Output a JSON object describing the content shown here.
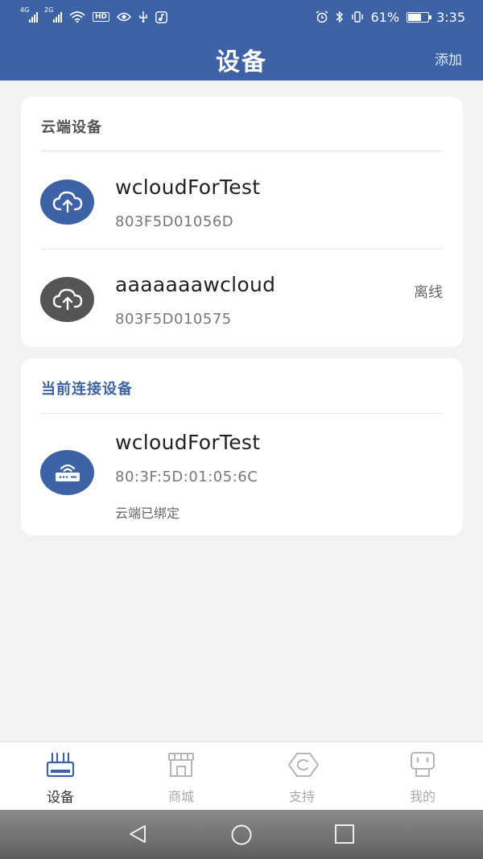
{
  "status_bar": {
    "signal1_tag": "4G",
    "signal2_tag": "2G",
    "hd_badge": "HD",
    "battery_percent": "61%",
    "battery_level": 0.61,
    "time": "3:35"
  },
  "header": {
    "title": "设备",
    "add_label": "添加"
  },
  "cloud_section": {
    "title": "云端设备",
    "devices": [
      {
        "name": "wcloudForTest",
        "mac": "803F5D01056D",
        "status": "",
        "icon": "cloud-upload-icon",
        "color": "#3d63a6"
      },
      {
        "name": "aaaaaaawcloud",
        "mac": "803F5D010575",
        "status": "离线",
        "icon": "cloud-upload-icon",
        "color": "#555555"
      }
    ]
  },
  "connected_section": {
    "title": "当前连接设备",
    "device": {
      "name": "wcloudForTest",
      "mac": "80:3F:5D:01:05:6C",
      "note": "云端已绑定",
      "icon": "router-icon",
      "color": "#3d63a6"
    }
  },
  "tabs": [
    {
      "label": "设备",
      "icon": "router-tab-icon",
      "active": true
    },
    {
      "label": "商城",
      "icon": "store-icon",
      "active": false
    },
    {
      "label": "支持",
      "icon": "support-icon",
      "active": false
    },
    {
      "label": "我的",
      "icon": "robot-profile-icon",
      "active": false
    }
  ],
  "colors": {
    "primary": "#3d63a6",
    "offline_gray": "#555555",
    "tab_inactive": "#aaaaaa"
  }
}
